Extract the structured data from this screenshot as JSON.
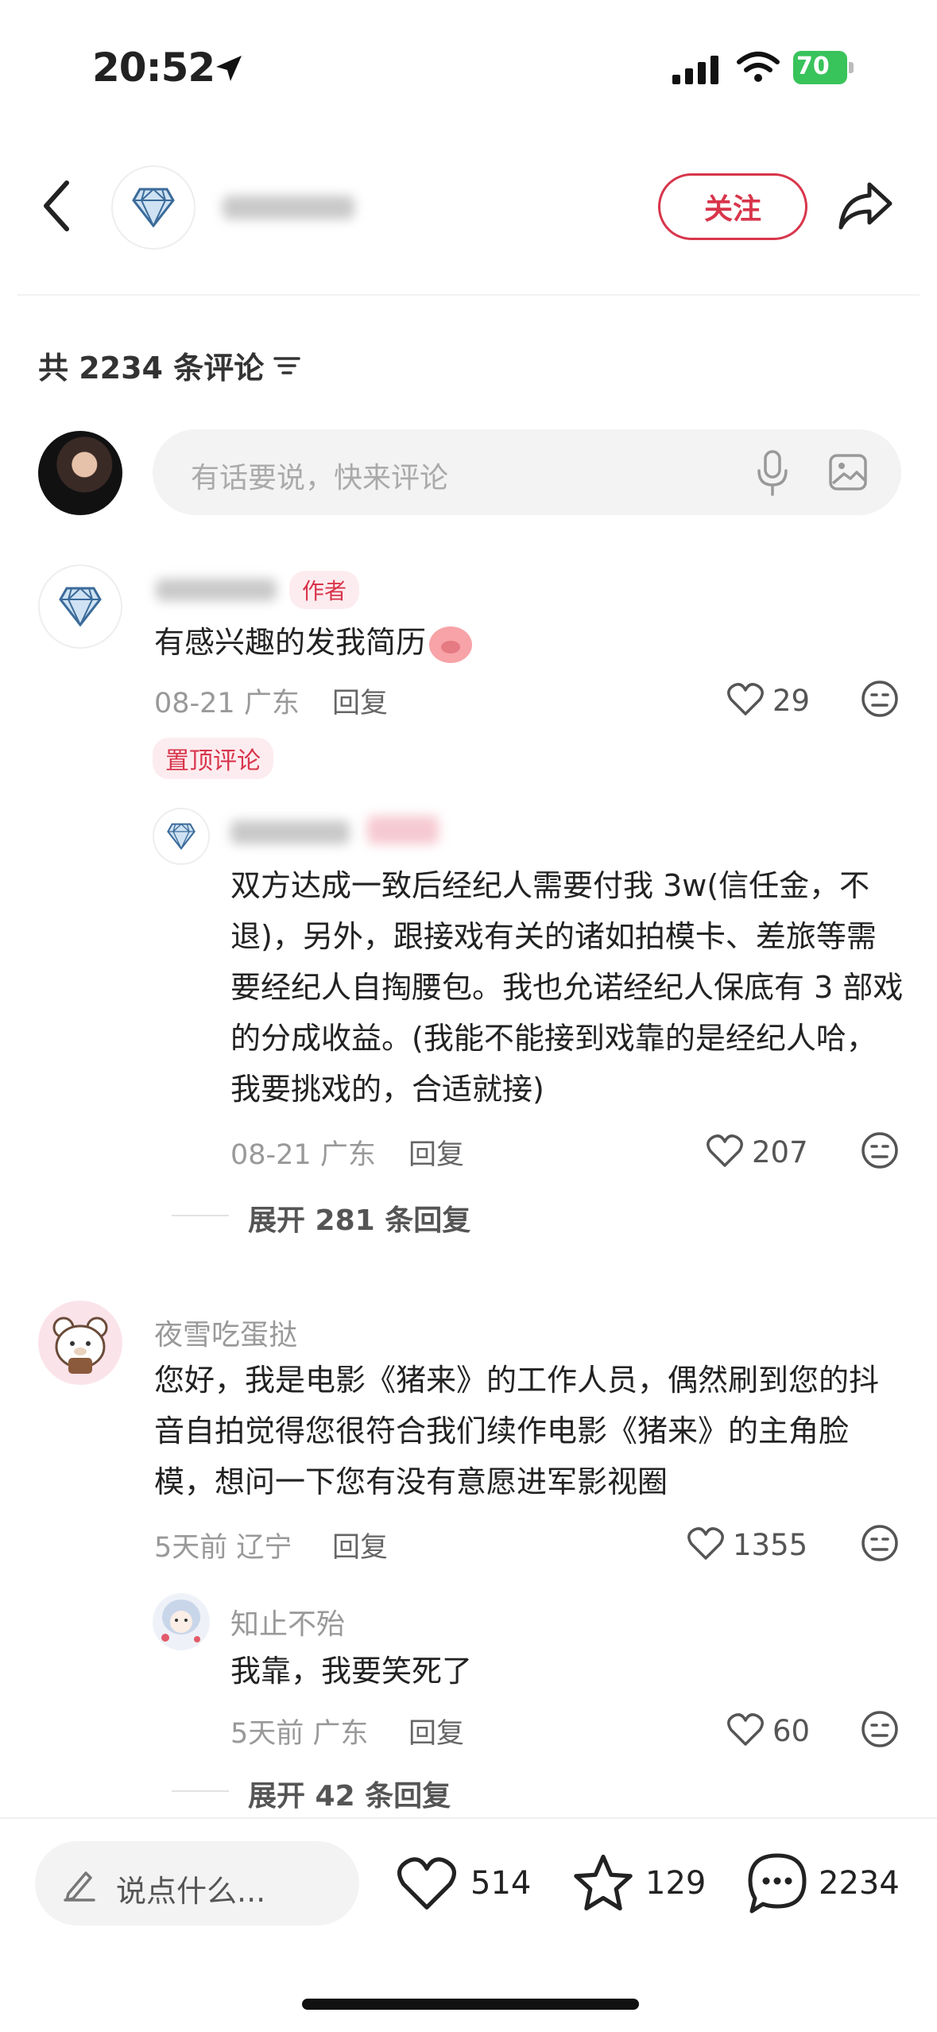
{
  "status_bar": {
    "time": "20:52",
    "battery": "70"
  },
  "header": {
    "follow_label": "关注"
  },
  "comments_header": {
    "count_label": "共 2234 条评论"
  },
  "input": {
    "placeholder": "有话要说，快来评论"
  },
  "comments": [
    {
      "author_tag": "作者",
      "text": "有感兴趣的发我简历",
      "date": "08-21 广东",
      "reply_label": "回复",
      "likes": "29",
      "pinned_label": "置顶评论",
      "replies": [
        {
          "text": "双方达成一致后经纪人需要付我 3w(信任金，不退)，另外，跟接戏有关的诸如拍模卡、差旅等需要经纪人自掏腰包。我也允诺经纪人保底有 3 部戏的分成收益。(我能不能接到戏靠的是经纪人哈，我要挑戏的，合适就接)",
          "date": "08-21 广东",
          "reply_label": "回复",
          "likes": "207"
        }
      ],
      "expand_label": "展开 281 条回复"
    },
    {
      "author": "夜雪吃蛋挞",
      "text": "您好，我是电影《猪来》的工作人员，偶然刷到您的抖音自拍觉得您很符合我们续作电影《猪来》的主角脸模，想问一下您有没有意愿进军影视圈",
      "date": "5天前 辽宁",
      "reply_label": "回复",
      "likes": "1355",
      "replies": [
        {
          "author": "知止不殆",
          "text": "我靠，我要笑死了",
          "date": "5天前 广东",
          "reply_label": "回复",
          "likes": "60"
        }
      ],
      "expand_label": "展开 42 条回复"
    }
  ],
  "bottom_bar": {
    "say_placeholder": "说点什么...",
    "likes": "514",
    "favorites": "129",
    "comments": "2234"
  },
  "colors": {
    "accent": "#d8354b",
    "battery": "#39c35b"
  }
}
